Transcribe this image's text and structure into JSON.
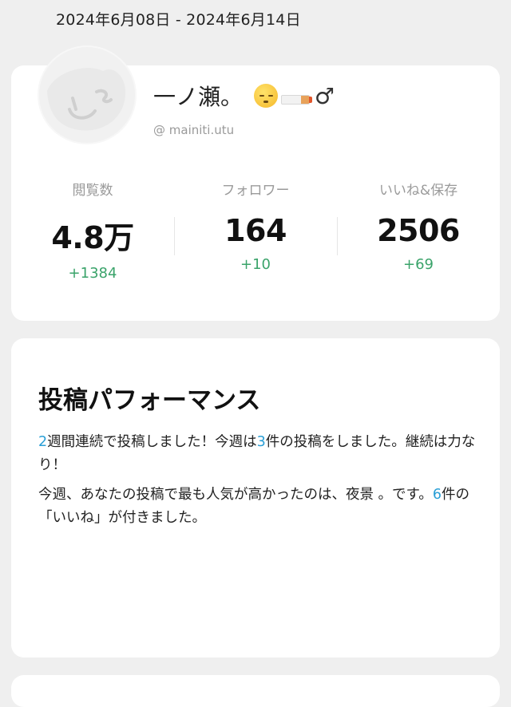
{
  "date_range": "2024年6月08日 - 2024年6月14日",
  "profile": {
    "name": "一ノ瀬。",
    "status_icons": [
      "sleeping-face-icon",
      "cigarette-icon",
      "male-sign-icon"
    ],
    "male_sign": "♂",
    "handle": "@ mainiti.utu"
  },
  "stats": [
    {
      "label": "閲覧数",
      "value": "4.8万",
      "delta": "+1384"
    },
    {
      "label": "フォロワー",
      "value": "164",
      "delta": "+10"
    },
    {
      "label": "いいね&保存",
      "value": "2506",
      "delta": "+69"
    }
  ],
  "performance": {
    "title": "投稿パフォーマンス",
    "para1": {
      "weeks": "2",
      "text_a": "週間連続で投稿しました！今週は",
      "posts": "3",
      "text_b": "件の投稿をしました。継続は力なり！"
    },
    "para2": {
      "text_a": "今週、あなたの投稿で最も人気が高かったのは、夜景 。です。",
      "likes": "6",
      "text_b": "件の「いいね」が付きました。"
    }
  },
  "colors": {
    "accent_number": "#2a9fd6",
    "delta_green": "#3aa36a",
    "background": "#efefef"
  }
}
